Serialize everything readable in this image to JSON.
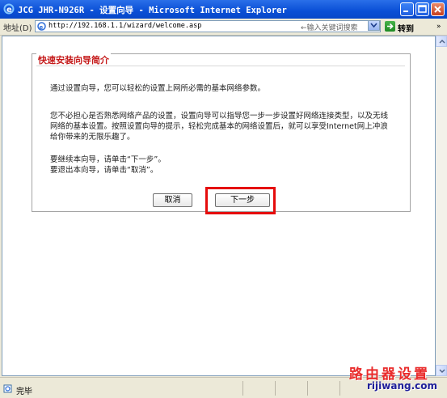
{
  "window": {
    "title": "JCG JHR-N926R - 设置向导 - Microsoft Internet Explorer"
  },
  "address_bar": {
    "label": "地址(D)",
    "url": "http://192.168.1.1/wizard/welcome.asp",
    "search_hint": "←输入关键词搜索",
    "go_label": "转到",
    "links_arrow": "»"
  },
  "wizard": {
    "heading": "快速安装向导简介",
    "intro": "通过设置向导，您可以轻松的设置上网所必需的基本网络参数。",
    "description": "您不必担心是否熟悉网络产品的设置，设置向导可以指导您一步一步设置好网络连接类型，以及无线网络的基本设置。按照设置向导的提示，轻松完成基本的网络设置后，就可以享受Internet网上冲浪给你带来的无限乐趣了。",
    "continue_line": "要继续本向导，请单击“下一步”。",
    "exit_line": "要退出本向导，请单击“取消”。",
    "cancel_label": "取消",
    "next_label": "下一步"
  },
  "status_bar": {
    "text": "完毕"
  },
  "watermark": {
    "title": "路由器设置",
    "site": "rijiwang.com"
  },
  "colors": {
    "highlight": "#E50C0C",
    "heading": "#C51A1A",
    "titlebar": "#0A4FD6"
  }
}
